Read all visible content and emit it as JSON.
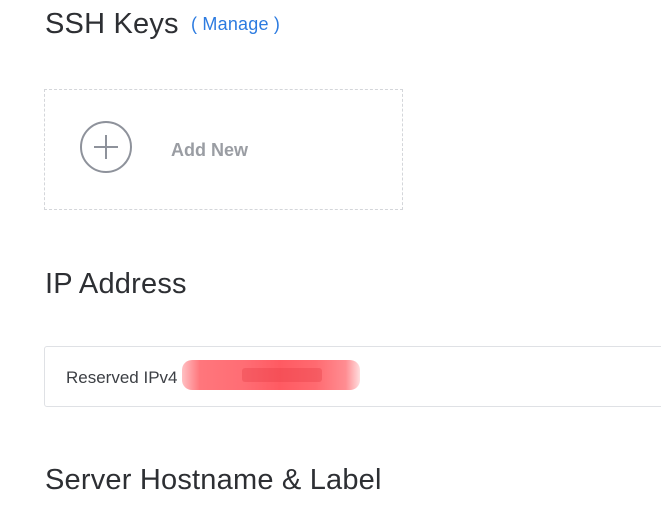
{
  "ssh_keys": {
    "title": "SSH Keys",
    "manage_label": "( Manage )",
    "add_new_label": "Add New"
  },
  "ip_address": {
    "title": "IP Address",
    "value_prefix": "Reserved IPv4"
  },
  "server_hostname": {
    "title": "Server Hostname & Label"
  },
  "colors": {
    "link": "#2c7be0",
    "muted_text": "#9a9da3",
    "heading": "#2d2f33",
    "redaction": "#ff6d74"
  }
}
